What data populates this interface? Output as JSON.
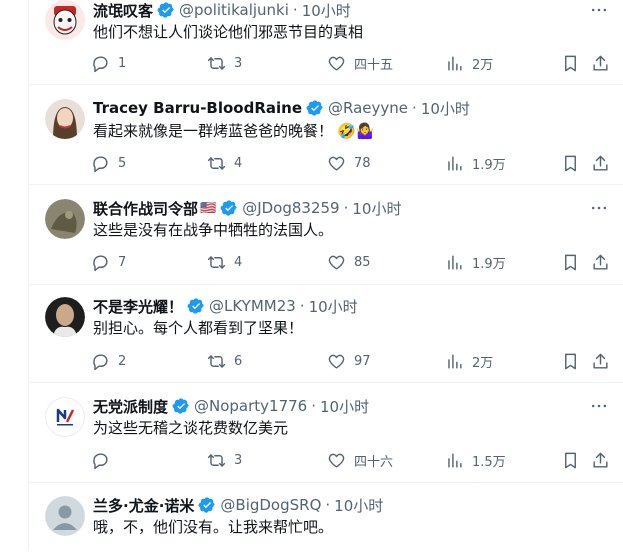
{
  "tweets": [
    {
      "name": "流氓叹客",
      "handle": "@politikaljunki",
      "time": "10小时",
      "text": "他们不想让人们谈论他们邪恶节目的真相",
      "emoji": "",
      "replies": "1",
      "retweets": "3",
      "likes": "四十五",
      "views": "2万",
      "avatar_color": "#d32f2f"
    },
    {
      "name": "Tracey Barru-BloodRaine",
      "handle": "@Raeyyne",
      "time": "10小时",
      "text": "看起来就像是一群烤蓝爸爸的晚餐！",
      "emoji": "🤣🤷‍♀️",
      "replies": "5",
      "retweets": "4",
      "likes": "78",
      "views": "1.9万",
      "avatar_color": "#c8b8a8"
    },
    {
      "name": "联合作战司令部",
      "flag": "🇺🇸",
      "handle": "@JDog83259",
      "time": "10小时",
      "text": "这些是没有在战争中牺牲的法国人。",
      "emoji": "",
      "replies": "7",
      "retweets": "4",
      "likes": "85",
      "views": "1.9万",
      "avatar_color": "#7a7560"
    },
    {
      "name": "不是李光耀！",
      "handle": "@LKYMM23",
      "time": "10小时",
      "text": "别担心。每个人都看到了坚果！",
      "emoji": "",
      "replies": "2",
      "retweets": "6",
      "likes": "97",
      "views": "2万",
      "avatar_color": "#2f2f2f"
    },
    {
      "name": "无党派制度",
      "handle": "@Noparty1776",
      "time": "10小时",
      "text": "为这些无稽之谈花费数亿美元",
      "emoji": "",
      "replies": "",
      "retweets": "3",
      "likes": "四十六",
      "views": "1.5万",
      "avatar_color": "#ffffff"
    },
    {
      "name": "兰多·尤金·诺米",
      "handle": "@BigDogSRQ",
      "time": "10小时",
      "text": "哦，不，他们没有。让我来帮忙吧。",
      "emoji": "",
      "avatar_color": "#cfd9de"
    }
  ],
  "colors": {
    "verified": "#1d9bf0",
    "muted": "#536471",
    "divider": "#eff3f4"
  }
}
